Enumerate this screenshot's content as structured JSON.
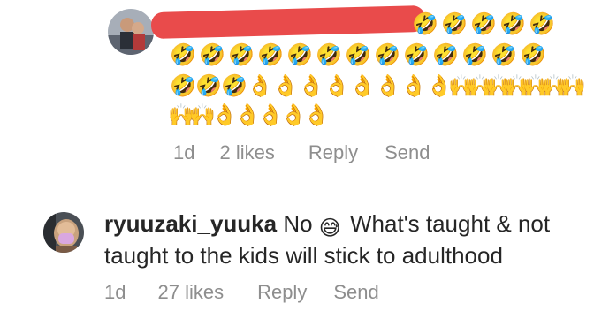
{
  "comments": [
    {
      "avatar_icon": "profile-photo-icon",
      "username_redacted": true,
      "emoji_rows": [
        [
          "🤣",
          "🤣",
          "🤣",
          "🤣",
          "🤣"
        ],
        [
          "🤣",
          "🤣",
          "🤣",
          "🤣",
          "🤣",
          "🤣",
          "🤣",
          "🤣",
          "🤣",
          "🤣",
          "🤣",
          "🤣",
          "🤣"
        ],
        [
          "🤣",
          "🤣",
          "🤣",
          "👌",
          "👌",
          "👌",
          "👌",
          "👌",
          "👌",
          "👌",
          "👌",
          "🙌",
          "🙌",
          "🙌",
          "🙌",
          "🙌",
          "🙌",
          "🙌"
        ],
        [
          "🙌",
          "🙌",
          "👌",
          "👌",
          "👌",
          "👌",
          "👌"
        ]
      ],
      "time": "1d",
      "likes": "2 likes",
      "reply_label": "Reply",
      "send_label": "Send"
    },
    {
      "avatar_icon": "profile-photo-icon",
      "username": "ryuuzaki_yuuka",
      "text_before_emoji": " No ",
      "emoji": "😅",
      "text_after_emoji": " What's taught & not taught to the kids will stick to adulthood",
      "time": "1d",
      "likes": "27 likes",
      "reply_label": "Reply",
      "send_label": "Send"
    }
  ],
  "colors": {
    "redaction": "#e94b4b",
    "meta_text": "#8e8e8e",
    "body_text": "#262626"
  }
}
